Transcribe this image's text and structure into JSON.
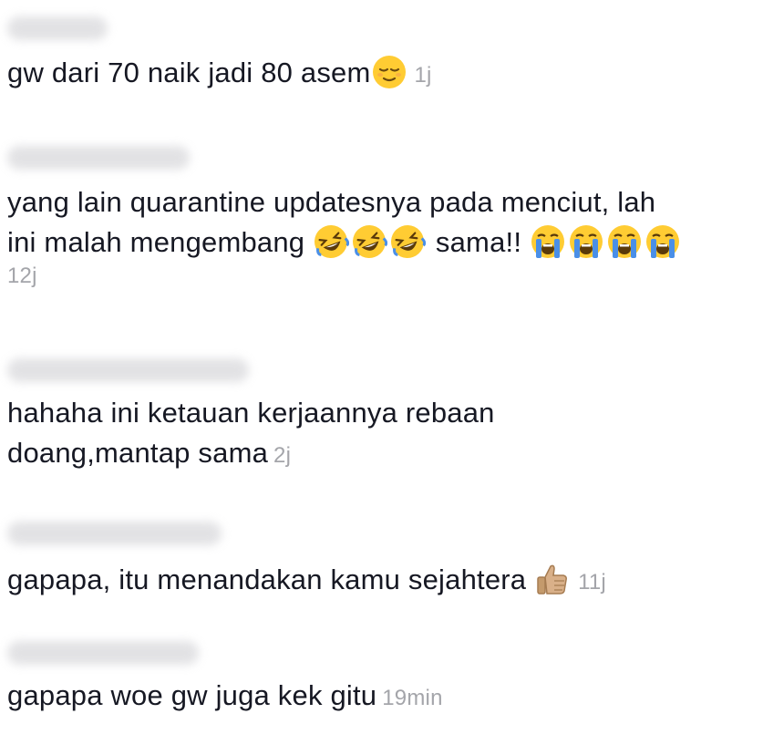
{
  "comments": [
    {
      "text": "gw dari 70 naik jadi 80 asem",
      "emojis": [
        "relieved-face-emoji"
      ],
      "time": "1j"
    },
    {
      "text_line1": "yang lain quarantine updatesnya pada menciut, lah",
      "text_line2a": "ini malah mengembang",
      "text_line2b": "sama!!",
      "emojis_a": [
        "rolling-laughing-emoji",
        "rolling-laughing-emoji",
        "rolling-laughing-emoji"
      ],
      "emojis_b": [
        "loudly-crying-emoji",
        "loudly-crying-emoji",
        "loudly-crying-emoji",
        "loudly-crying-emoji"
      ],
      "time": "12j"
    },
    {
      "text_line1": "hahaha ini ketauan kerjaannya rebaan",
      "text_line2": "doang,mantap sama",
      "time": "2j"
    },
    {
      "text": "gapapa, itu menandakan kamu sejahtera",
      "emojis": [
        "thumbs-up-emoji"
      ],
      "time": "11j"
    },
    {
      "text": "gapapa woe gw juga kek gitu",
      "time": "19min"
    }
  ],
  "colors": {
    "text": "#161823",
    "time": "#a4a5aa",
    "emoji_face": "#ffcc33",
    "tears": "#4a8fe7",
    "thumb": "#d9b089"
  }
}
